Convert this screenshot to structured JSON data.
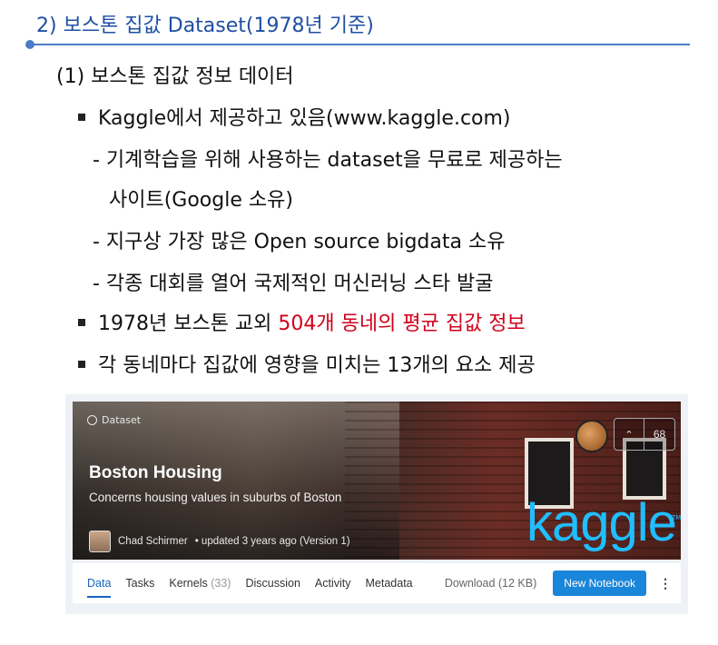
{
  "section_title": "2) 보스톤 집값 Dataset(1978년 기준)",
  "heading": "(1) 보스톤 집값 정보 데이터",
  "bullets": {
    "b1": "Kaggle에서 제공하고 있음(www.kaggle.com)",
    "d1": "- 기계학습을 위해 사용하는 dataset을 무료로 제공하는",
    "d1_cont": "사이트(Google 소유)",
    "d2": "- 지구상 가장 많은 Open source bigdata 소유",
    "d3": "- 각종 대회를 열어 국제적인 머신러닝 스타 발굴",
    "b2_pre": "1978년 보스톤 교외 ",
    "b2_red": "504개 동네의 평균 집값 정보",
    "b3": "각 동네마다 집값에 영향을 미치는 13개의 요소 제공"
  },
  "kaggle": {
    "dataset_label": "Dataset",
    "title": "Boston Housing",
    "subtitle": "Concerns housing values in suburbs of Boston",
    "logo_text": "kaggle",
    "vote_count": "68",
    "author": "Chad Schirmer",
    "updated": "• updated 3 years ago (Version 1)",
    "tabs": [
      "Data",
      "Tasks",
      "Kernels",
      "Discussion",
      "Activity",
      "Metadata"
    ],
    "kernels_count": "(33)",
    "download": "Download (12 KB)",
    "new_notebook": "New Notebook",
    "accent_color": "#1a86d9",
    "logo_color": "#20beff"
  },
  "colors": {
    "title": "#1f4fa3",
    "highlight": "#d0021b"
  }
}
